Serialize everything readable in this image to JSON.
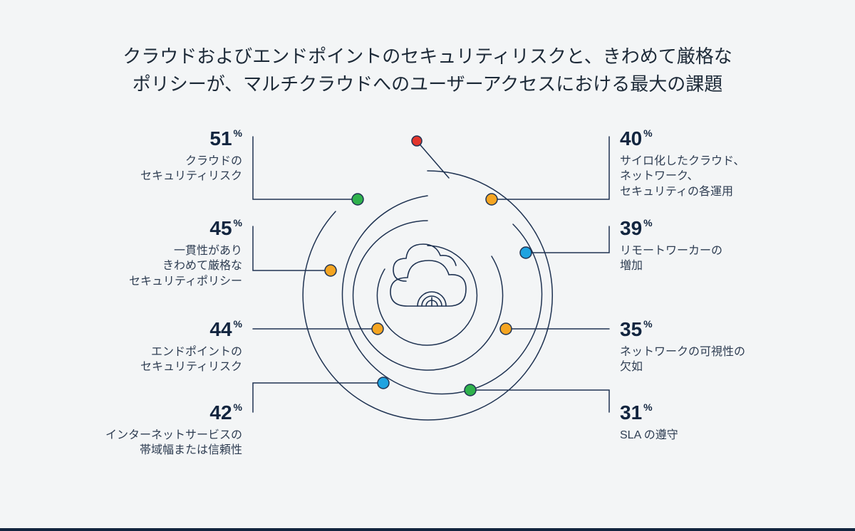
{
  "title_line1": "クラウドおよびエンドポイントのセキュリティリスクと、きわめて厳格な",
  "title_line2": "ポリシーが、マルチクラウドへのユーザーアクセスにおける最大の課題",
  "pct_suffix": "%",
  "left": [
    {
      "pct": "51",
      "txt_l1": "クラウドの",
      "txt_l2": "セキュリティリスク"
    },
    {
      "pct": "45",
      "txt_l1": "一貫性があり",
      "txt_l2": "きわめて厳格な",
      "txt_l3": "セキュリティポリシー"
    },
    {
      "pct": "44",
      "txt_l1": "エンドポイントの",
      "txt_l2": "セキュリティリスク"
    },
    {
      "pct": "42",
      "txt_l1": "インターネットサービスの",
      "txt_l2": "帯域幅または信頼性"
    }
  ],
  "right": [
    {
      "pct": "40",
      "txt_l1": "サイロ化したクラウド、",
      "txt_l2": "ネットワーク、",
      "txt_l3": "セキュリティの各運用"
    },
    {
      "pct": "39",
      "txt_l1": "リモートワーカーの",
      "txt_l2": "増加"
    },
    {
      "pct": "35",
      "txt_l1": "ネットワークの可視性の",
      "txt_l2": "欠如"
    },
    {
      "pct": "31",
      "txt_l1": "SLA の遵守"
    }
  ],
  "colors": {
    "stroke": "#1f3352",
    "green": "#2fb24c",
    "orange": "#f5a522",
    "blue": "#1fa3e0",
    "red": "#e3362d"
  },
  "chart_data": {
    "type": "table",
    "title": "クラウドおよびエンドポイントのセキュリティリスクと、きわめて厳格なポリシーが、マルチクラウドへのユーザーアクセスにおける最大の課題",
    "series": [
      {
        "name": "クラウドのセキュリティリスク",
        "value": 51,
        "unit": "%"
      },
      {
        "name": "一貫性がありきわめて厳格なセキュリティポリシー",
        "value": 45,
        "unit": "%"
      },
      {
        "name": "エンドポイントのセキュリティリスク",
        "value": 44,
        "unit": "%"
      },
      {
        "name": "インターネットサービスの帯域幅または信頼性",
        "value": 42,
        "unit": "%"
      },
      {
        "name": "サイロ化したクラウド、ネットワーク、セキュリティの各運用",
        "value": 40,
        "unit": "%"
      },
      {
        "name": "リモートワーカーの増加",
        "value": 39,
        "unit": "%"
      },
      {
        "name": "ネットワークの可視性の欠如",
        "value": 35,
        "unit": "%"
      },
      {
        "name": "SLA の遵守",
        "value": 31,
        "unit": "%"
      }
    ]
  }
}
